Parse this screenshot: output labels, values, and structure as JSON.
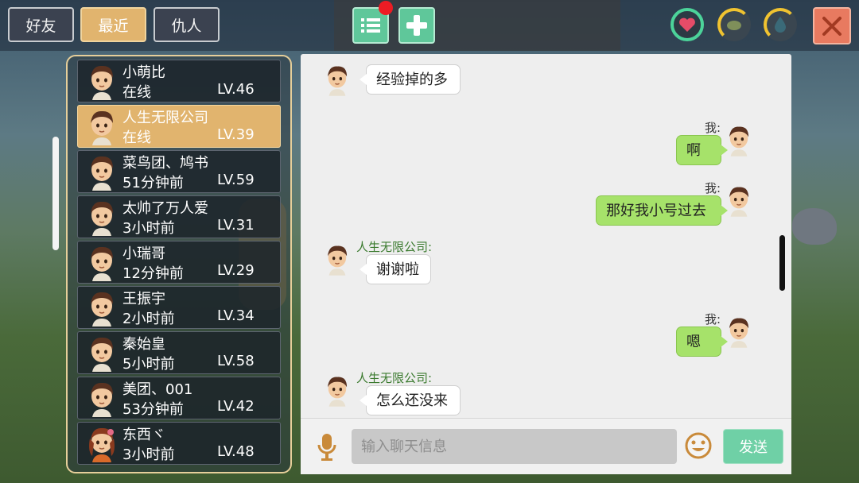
{
  "tabs": [
    {
      "label": "好友"
    },
    {
      "label": "最近"
    },
    {
      "label": "仇人"
    }
  ],
  "toolbar": {
    "list_icon": "list-icon",
    "add_icon": "plus-icon",
    "status_icons": [
      "heart-icon",
      "stamina-icon",
      "water-drop-icon"
    ],
    "close_icon": "close-icon"
  },
  "friends": [
    {
      "name": "小萌比",
      "status": "在线",
      "level": "LV.46"
    },
    {
      "name": "人生无限公司",
      "status": "在线",
      "level": "LV.39",
      "selected": true
    },
    {
      "name": "菜鸟团、鸠书",
      "status": "51分钟前",
      "level": "LV.59"
    },
    {
      "name": "太帅了万人爱",
      "status": "3小时前",
      "level": "LV.31"
    },
    {
      "name": "小瑞哥",
      "status": "12分钟前",
      "level": "LV.29"
    },
    {
      "name": "王振宇",
      "status": "2小时前",
      "level": "LV.34"
    },
    {
      "name": "秦始皇",
      "status": "5小时前",
      "level": "LV.58"
    },
    {
      "name": "美团、001",
      "status": "53分钟前",
      "level": "LV.42"
    },
    {
      "name": "东西ヾ",
      "status": "3小时前",
      "level": "LV.48"
    }
  ],
  "chat": {
    "messages": [
      {
        "from": "other",
        "sender": "",
        "text": "经验掉的多"
      },
      {
        "from": "me",
        "sender": "我:",
        "text": "啊"
      },
      {
        "from": "me",
        "sender": "我:",
        "text": "那好我小号过去"
      },
      {
        "from": "other",
        "sender": "人生无限公司:",
        "text": "谢谢啦"
      },
      {
        "from": "me",
        "sender": "我:",
        "text": "嗯"
      },
      {
        "from": "other",
        "sender": "人生无限公司:",
        "text": "怎么还没来"
      }
    ],
    "input_placeholder": "输入聊天信息",
    "send_label": "发送",
    "mic_icon": "microphone-icon",
    "emoji_icon": "smiley-icon"
  },
  "colors": {
    "tab_active": "#e1b46e",
    "green_button": "#5fc79a",
    "bubble_me": "#a6e26a",
    "close": "#e87a60"
  }
}
